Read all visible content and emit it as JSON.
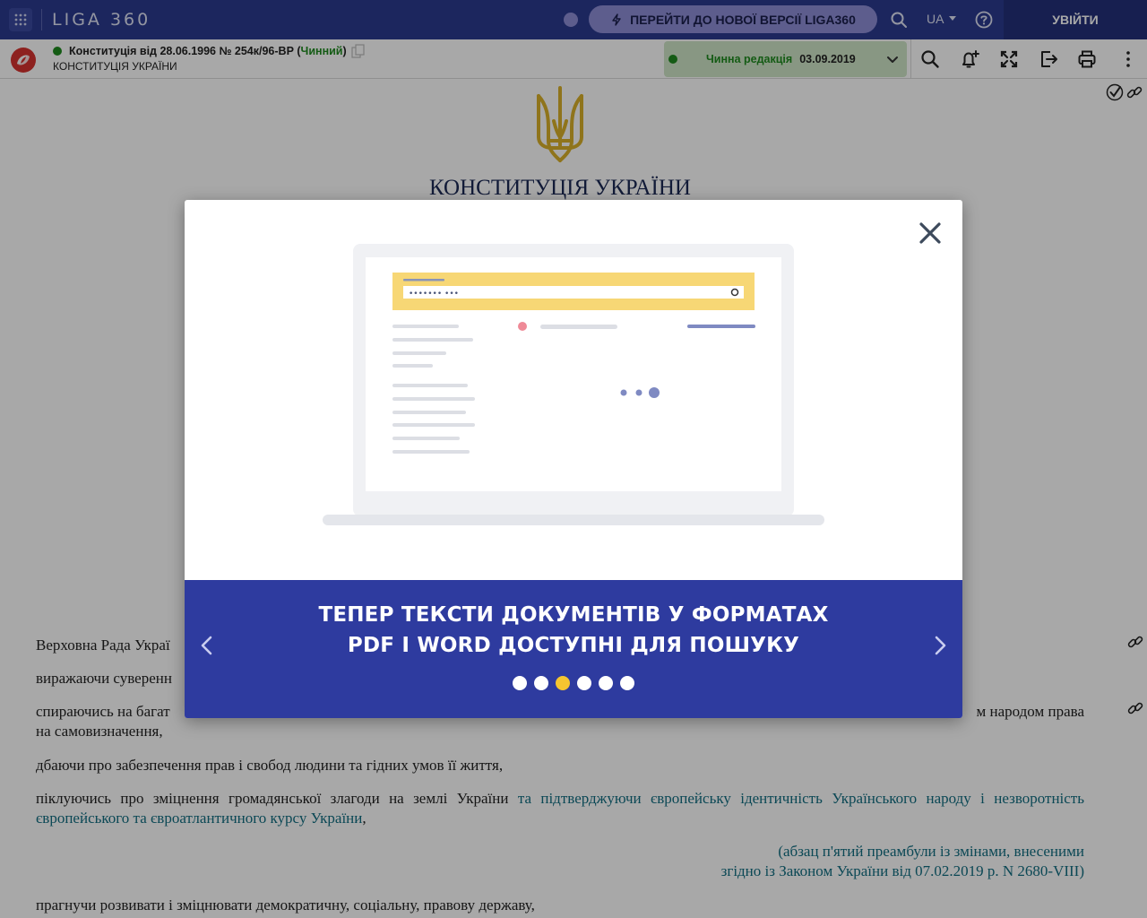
{
  "topbar": {
    "logo": "LIGA 360",
    "new_version_label": "ПЕРЕЙТИ ДО НОВОЇ ВЕРСІЇ LIGA360",
    "language": "UA",
    "login_label": "УВІЙТИ"
  },
  "document": {
    "title": "Конституція від 28.06.1996 № 254к/96-ВР",
    "status": "Чинний",
    "subtitle": "КОНСТИТУЦІЯ УКРАЇНИ",
    "edition_label": "Чинна редакція",
    "edition_date": "03.09.2019",
    "heading": "КОНСТИТУЦІЯ УКРАЇНИ",
    "paragraphs": {
      "p1": "Верховна Рада Украї",
      "p2": "виражаючи суверенн",
      "p3_start": "спираючись на багат",
      "p3_end": "м народом права",
      "p3_line2": "на самовизначення,",
      "p4": "дбаючи про забезпечення прав і свобод людини та гідних умов її життя,",
      "p5_main": "піклуючись про зміцнення громадянської злагоди на землі України ",
      "p5_amend": "та підтверджуючи європейську ідентичність Українського народу і незворотність європейського та євроатлантичного курсу України",
      "p5_end": ",",
      "note_line1": "(абзац п'ятий преамбули із змінами, внесеними",
      "note_line2": "згідно із Законом України від 07.02.2019 р. N 2680-VIII)",
      "p6": "прагнучи розвивати і зміцнювати демократичну, соціальну, правову державу,"
    }
  },
  "modal": {
    "title_line1": "ТЕПЕР ТЕКСТИ ДОКУМЕНТІВ У ФОРМАТАХ",
    "title_line2": "PDF І WORD ДОСТУПНІ ДЛЯ ПОШУКУ",
    "slide_count": 6,
    "active_slide": 3,
    "search_mock_text": "••••••• •••"
  },
  "colors": {
    "topbar": "#2b3a8f",
    "banner": "#2e3b9f",
    "active_dot": "#f5c530",
    "valid_green": "#1f8a1f",
    "amend_teal": "#126e82"
  }
}
